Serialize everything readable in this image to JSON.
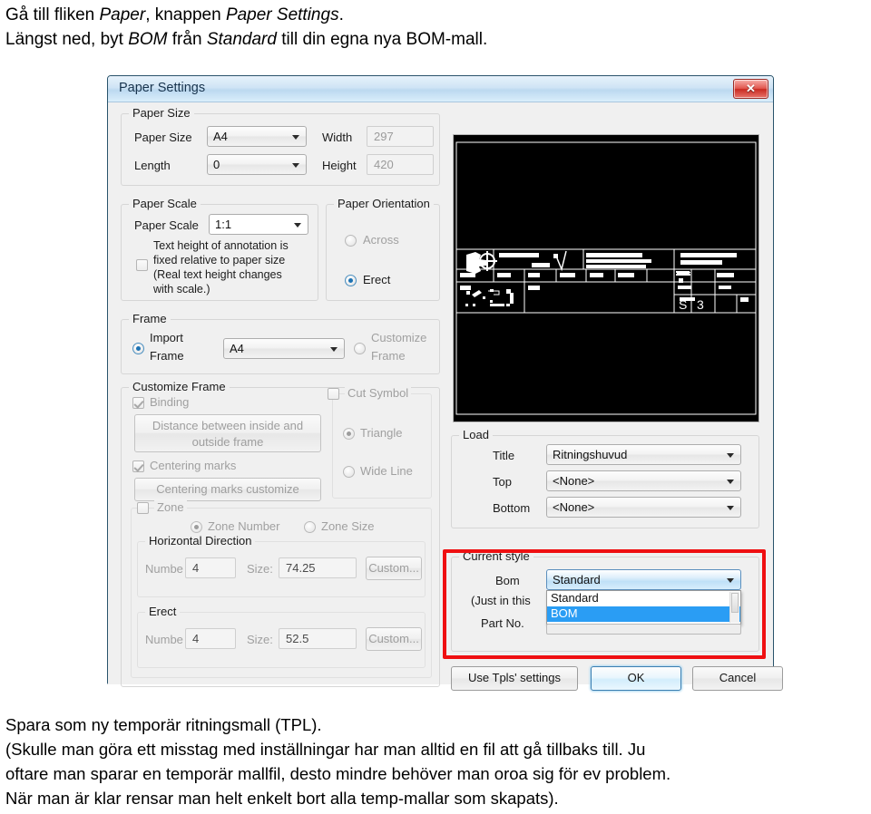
{
  "instructions": {
    "line1_a": "Gå till fliken ",
    "line1_b": "Paper",
    "line1_c": ", knappen ",
    "line1_d": "Paper Settings",
    "line1_e": ".",
    "line2_a": "Längst ned, byt ",
    "line2_b": "BOM",
    "line2_c": " från ",
    "line2_d": "Standard",
    "line2_e": " till din egna nya BOM-mall."
  },
  "dialog": {
    "title": "Paper Settings",
    "close_label": "✕",
    "paper_size": {
      "legend": "Paper Size",
      "paper_size_label": "Paper Size",
      "paper_size_value": "A4",
      "length_label": "Length",
      "length_value": "0",
      "width_label": "Width",
      "width_value": "297",
      "height_label": "Height",
      "height_value": "420"
    },
    "paper_scale": {
      "legend": "Paper Scale",
      "scale_label": "Paper Scale",
      "scale_value": "1:1",
      "checkbox_line1": "Text height of annotation is",
      "checkbox_line2": "fixed relative to paper size",
      "checkbox_line3": "(Real text height changes",
      "checkbox_line4": "with scale.)",
      "checkbox_checked": false
    },
    "paper_orientation": {
      "legend": "Paper Orientation",
      "across_label": "Across",
      "erect_label": "Erect",
      "selected": "Erect"
    },
    "frame": {
      "legend": "Frame",
      "import_label_l1": "Import",
      "import_label_l2": "Frame",
      "frame_value": "A4",
      "customize_label_l1": "Customize",
      "customize_label_l2": "Frame",
      "selected": "Import Frame"
    },
    "customize_frame": {
      "legend": "Customize Frame",
      "binding_label": "Binding",
      "binding_checked": true,
      "distance_button_l1": "Distance between inside and",
      "distance_button_l2": "outside frame",
      "centering_marks_label": "Centering marks",
      "centering_marks_checked": true,
      "centering_button": "Centering marks customize",
      "zone_label": "Zone",
      "zone_checked": false,
      "zone_number_label": "Zone Number",
      "zone_size_label": "Zone Size",
      "zone_selected": "Zone Number",
      "cut_symbol_label": "Cut Symbol",
      "cut_symbol_checked": false,
      "triangle_label": "Triangle",
      "wide_line_label": "Wide Line",
      "cut_symbol_selected": "Triangle"
    },
    "horizontal_direction": {
      "legend": "Horizontal Direction",
      "number_label": "Numbe",
      "number_value": "4",
      "size_label": "Size:",
      "size_value": "74.25",
      "custom_button": "Custom..."
    },
    "erect": {
      "legend": "Erect",
      "number_label": "Numbe",
      "number_value": "4",
      "size_label": "Size:",
      "size_value": "52.5",
      "custom_button": "Custom..."
    },
    "load": {
      "legend": "Load",
      "title_label": "Title",
      "title_value": "Ritningshuvud",
      "top_label": "Top",
      "top_value": "<None>",
      "bottom_label": "Bottom",
      "bottom_value": "<None>"
    },
    "current_style": {
      "legend": "Current style",
      "bom_label": "Bom",
      "just_in_this_label": "(Just in this",
      "part_no_label": "Part No.",
      "bom_value": "Standard",
      "options": [
        "Standard",
        "BOM"
      ],
      "highlighted_option": "BOM",
      "highlight_color": "#ef0f11"
    },
    "buttons": {
      "use_tpls": "Use Tpls' settings",
      "ok": "OK",
      "cancel": "Cancel"
    }
  },
  "outro": {
    "line1": "Spara som ny temporär ritningsmall (TPL).",
    "line2": "(Skulle man göra ett misstag med inställningar har man alltid en fil att gå tillbaks till. Ju",
    "line3": "oftare man sparar en temporär mallfil, desto mindre behöver man oroa sig för ev problem.",
    "line4": "När man är klar rensar man helt enkelt bort alla temp-mallar som skapats)."
  }
}
